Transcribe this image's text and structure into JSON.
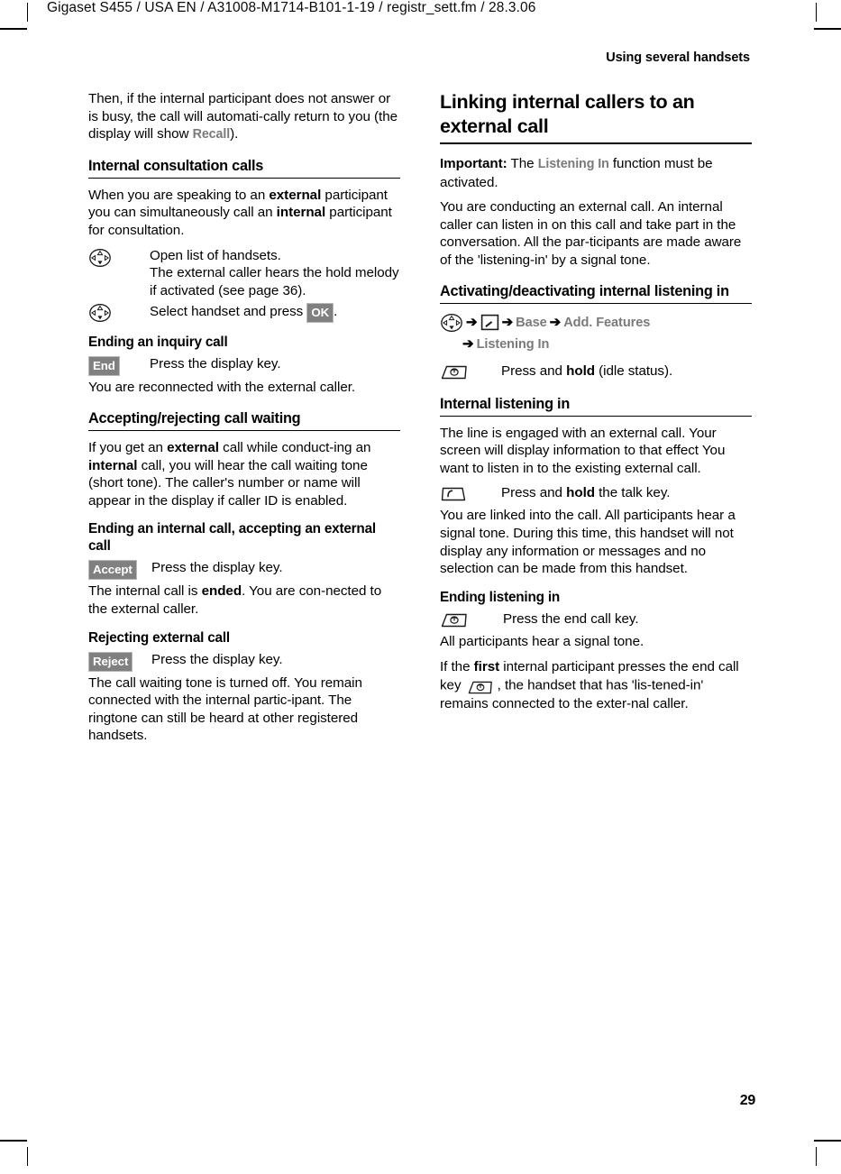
{
  "header": {
    "folio_line": "Gigaset S455 / USA EN / A31008-M1714-B101-1-19  / registr_sett.fm / 28.3.06",
    "running_head": "Using several handsets"
  },
  "footer": {
    "page_number": "29"
  },
  "left_column": {
    "intro": {
      "text_before": "Then, if the internal participant does not answer or is busy, the call will automati-cally return to you (the display will show ",
      "display_word": "Recall",
      "text_after": ")."
    },
    "section_consultation": {
      "heading": "Internal consultation calls",
      "paragraph_1_a": "When you are speaking to an ",
      "paragraph_1_b": "external",
      "paragraph_1_c": " participant you can simultaneously call an ",
      "paragraph_1_d": "internal",
      "paragraph_1_e": " participant for consultation.",
      "rows": [
        {
          "icon": "nav-key-icon",
          "text": "Open list of handsets.\nThe external caller hears the hold melody if activated (see page 36)."
        }
      ],
      "row_select_a": "Select handset and press ",
      "row_select_key": "OK",
      "row_select_b": "."
    },
    "section_ending_inquiry": {
      "heading": "Ending an inquiry call",
      "softkey": "End",
      "row_text": "Press the display key.",
      "paragraph": "You are reconnected with the external caller."
    },
    "section_call_waiting": {
      "heading": "Accepting/rejecting call waiting",
      "paragraph_a": "If you get an ",
      "paragraph_b": "external",
      "paragraph_c": " call while conduct-ing an ",
      "paragraph_d": "internal",
      "paragraph_e": " call, you will hear the call waiting tone (short tone). The caller's number or name will appear in the display if caller ID is enabled."
    },
    "section_ending_internal": {
      "heading": "Ending an internal call, accepting an external call",
      "softkey": "Accept",
      "row_text": "Press the display key.",
      "paragraph_a": "The internal call is ",
      "paragraph_b": "ended",
      "paragraph_c": ". You are con-nected to the external caller."
    },
    "section_rejecting": {
      "heading": "Rejecting external call",
      "softkey": "Reject",
      "row_text": "Press the display key.",
      "paragraph": "The call waiting tone is turned off. You remain connected with the internal partic-ipant. The ringtone can still be heard at other registered handsets."
    }
  },
  "right_column": {
    "section_linking": {
      "heading": "Linking internal callers to an external call",
      "important_label": "Important:",
      "important_a": " The ",
      "important_display": "Listening In",
      "important_b": " function must be activated.",
      "paragraph": "You are conducting an external call. An internal caller can listen in on this call and take part in the conversation. All the par-ticipants are made aware of the 'listening-in' by a signal tone."
    },
    "section_activating": {
      "heading": "Activating/deactivating internal listening in",
      "menu_path": {
        "start_icon": "nav-key-icon",
        "arrow": "➔",
        "settings_icon": "settings-menu-icon",
        "items": [
          "Base",
          "Add. Features",
          "Listening In"
        ]
      },
      "row_icon": "end-call-key-icon",
      "row_text_a": "Press and ",
      "row_text_b": "hold",
      "row_text_c": " (idle status)."
    },
    "section_internal_listening": {
      "heading": "Internal listening in",
      "paragraph": "The line is engaged with an external call. Your screen will display information to that effect You want to listen in to the existing external call.",
      "row_icon": "talk-key-icon",
      "row_text_a": "Press and ",
      "row_text_b": "hold",
      "row_text_c": " the talk key.",
      "paragraph_2": "You are linked into the call. All participants hear a signal tone. During this time, this handset will not display any information or messages and no selection can be made from this handset."
    },
    "section_ending_listening": {
      "heading": "Ending listening in",
      "row_icon": "end-call-key-icon",
      "row_text": "Press the end call key.",
      "paragraph": "All participants hear a signal tone.",
      "paragraph_2_a": "If the ",
      "paragraph_2_b": "first",
      "paragraph_2_c": " internal participant presses the end call key ",
      "paragraph_2_icon": "end-call-key-icon",
      "paragraph_2_d": ", the handset that has 'lis-tened-in' remains connected to the exter-nal caller."
    }
  },
  "colors": {
    "display_text_gray": "#7a7a7a",
    "softkey_background": "#808080",
    "softkey_text": "#ffffff",
    "body_text": "#000000"
  }
}
